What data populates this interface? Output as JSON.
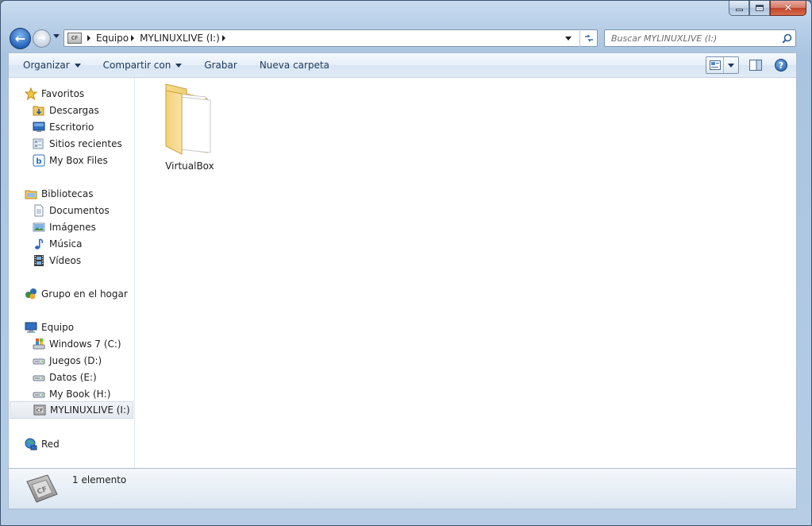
{
  "window": {
    "caption": {
      "minimize_icon": "minimize-icon",
      "maximize_icon": "maximize-icon",
      "close_icon": "close-icon"
    }
  },
  "navigation": {
    "back_icon": "back-arrow-icon",
    "forward_icon": "forward-arrow-icon",
    "breadcrumbs": [
      "Equipo",
      "MYLINUXLIVE (I:)"
    ],
    "drive_badge": "CF",
    "refresh_icon": "refresh-icon",
    "search_placeholder": "Buscar MYLINUXLIVE (I:)"
  },
  "toolbar": {
    "organize_label": "Organizar",
    "share_label": "Compartir con",
    "burn_label": "Grabar",
    "new_folder_label": "Nueva carpeta"
  },
  "sidebar": {
    "favorites": {
      "label": "Favoritos",
      "items": [
        "Descargas",
        "Escritorio",
        "Sitios recientes",
        "My Box Files"
      ]
    },
    "libraries": {
      "label": "Bibliotecas",
      "items": [
        "Documentos",
        "Imágenes",
        "Música",
        "Vídeos"
      ]
    },
    "homegroup": {
      "label": "Grupo en el hogar"
    },
    "computer": {
      "label": "Equipo",
      "items": [
        "Windows 7 (C:)",
        "Juegos (D:)",
        "Datos (E:)",
        "My Book (H:)",
        "MYLINUXLIVE (I:)"
      ],
      "selected": "MYLINUXLIVE (I:)"
    },
    "network": {
      "label": "Red"
    }
  },
  "content": {
    "items": [
      {
        "name": "VirtualBox",
        "type": "folder"
      }
    ]
  },
  "details": {
    "count_text": "1 elemento",
    "drive_badge": "CF"
  },
  "colors": {
    "frame": "#b9d0e8",
    "accent": "#1e395b",
    "folder": "#f2d27a"
  }
}
